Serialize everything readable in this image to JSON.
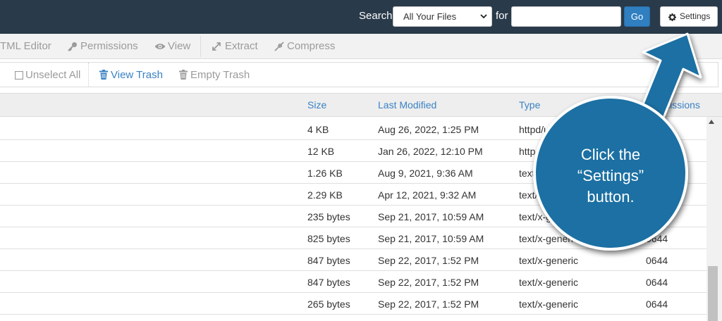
{
  "header": {
    "search_label": "Search",
    "scope_value": "All Your Files",
    "for_label": "for",
    "search_value": "",
    "go_label": "Go",
    "settings_label": "Settings"
  },
  "toolbar1": {
    "items": [
      {
        "label": "TML Editor",
        "icon": "none"
      },
      {
        "label": "Permissions",
        "icon": "key-icon"
      },
      {
        "label": "View",
        "icon": "eye-icon"
      },
      {
        "label": "Extract",
        "icon": "expand-icon"
      },
      {
        "label": "Compress",
        "icon": "compress-icon"
      }
    ]
  },
  "toolbar2": {
    "unselect_all": "Unselect All",
    "view_trash": "View Trash",
    "empty_trash": "Empty Trash"
  },
  "table": {
    "columns": {
      "size": "Size",
      "last_modified": "Last Modified",
      "type": "Type",
      "permissions": "ermissions"
    },
    "rows": [
      {
        "size": "4 KB",
        "modified": "Aug 26, 2022, 1:25 PM",
        "type": "httpd/u",
        "perm": ""
      },
      {
        "size": "12 KB",
        "modified": "Jan 26, 2022, 12:10 PM",
        "type": "http",
        "perm": ""
      },
      {
        "size": "1.26 KB",
        "modified": "Aug 9, 2021, 9:36 AM",
        "type": "text/",
        "perm": ""
      },
      {
        "size": "2.29 KB",
        "modified": "Apr 12, 2021, 9:32 AM",
        "type": "text/",
        "perm": ""
      },
      {
        "size": "235 bytes",
        "modified": "Sep 21, 2017, 10:59 AM",
        "type": "text/x-ge",
        "perm": ""
      },
      {
        "size": "825 bytes",
        "modified": "Sep 21, 2017, 10:59 AM",
        "type": "text/x-generic",
        "perm": "0644"
      },
      {
        "size": "847 bytes",
        "modified": "Sep 22, 2017, 1:52 PM",
        "type": "text/x-generic",
        "perm": "0644"
      },
      {
        "size": "847 bytes",
        "modified": "Sep 22, 2017, 1:52 PM",
        "type": "text/x-generic",
        "perm": "0644"
      },
      {
        "size": "265 bytes",
        "modified": "Sep 22, 2017, 1:52 PM",
        "type": "text/x-generic",
        "perm": "0644"
      }
    ]
  },
  "annotation": {
    "line1": "Click the",
    "line2": "“Settings”",
    "line3": "button."
  },
  "colors": {
    "header_bg": "#293a4a",
    "go_button": "#2f7fc1",
    "link_blue": "#3a82c4",
    "callout_blue": "#1c6fa3"
  }
}
